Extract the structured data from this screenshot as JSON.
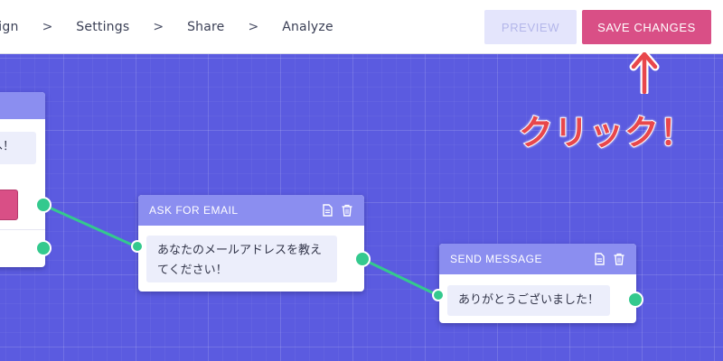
{
  "breadcrumbs": [
    {
      "label": "esign"
    },
    {
      "label": "Settings"
    },
    {
      "label": "Share"
    },
    {
      "label": "Analyze"
    }
  ],
  "separator": ">",
  "toolbar": {
    "preview_label": "PREVIEW",
    "save_label": "SAVE CHANGES"
  },
  "nodes": {
    "left_partial": {
      "message": "へ！"
    },
    "ask_email": {
      "title": "ASK FOR EMAIL",
      "message_line1": "あなたのメールアドレスを教え",
      "message_line2": "てください！",
      "icons": [
        "copy-icon",
        "trash-icon"
      ]
    },
    "send_message": {
      "title": "SEND MESSAGE",
      "message": "ありがとうございました！",
      "icons": [
        "copy-icon",
        "trash-icon"
      ]
    }
  },
  "annotation": {
    "text": "クリック！",
    "color": "#e8474c",
    "arrow": "up-arrow"
  },
  "colors": {
    "canvas": "#5b5be0",
    "node_header": "#8b8ef0",
    "connector": "#34c98e",
    "save_button": "#d94f86",
    "preview_button": "#e4e5fc"
  }
}
